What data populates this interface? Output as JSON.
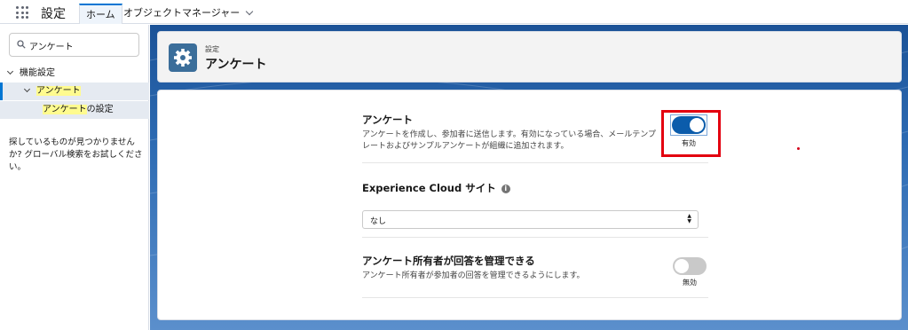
{
  "topbar": {
    "app_name": "設定",
    "tabs": [
      {
        "label": "ホーム"
      },
      {
        "label": "オブジェクトマネージャー"
      }
    ]
  },
  "sidebar": {
    "search_value": "アンケート",
    "tree": {
      "feature_settings": "機能設定",
      "survey": "アンケート",
      "survey_settings_prefix": "アンケート",
      "survey_settings_suffix": "の設定"
    },
    "help_text": "探しているものが見つかりませんか? グローバル検索をお試しください。"
  },
  "header": {
    "breadcrumb": "設定",
    "title": "アンケート",
    "icon": "gear-icon"
  },
  "settings": {
    "surveys": {
      "title": "アンケート",
      "description": "アンケートを作成し、参加者に送信します。有効になっている場合、メールテンプレートおよびサンプルアンケートが組織に追加されます。",
      "state": true,
      "state_label": "有効"
    },
    "experience_cloud": {
      "title": "Experience Cloud サイト",
      "info_icon": "info-icon",
      "selected": "なし"
    },
    "owner_manage": {
      "title": "アンケート所有者が回答を管理できる",
      "description": "アンケート所有者が参加者の回答を管理できるようにします。",
      "state": false,
      "state_label": "無効"
    }
  },
  "colors": {
    "brand": "#0176d3",
    "toggle_on": "#0b5cab",
    "annotation": "#e3000f"
  }
}
